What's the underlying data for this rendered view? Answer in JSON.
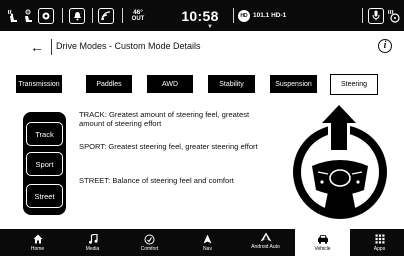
{
  "status_bar": {
    "temperature_value": "46°",
    "temperature_unit": "OUT",
    "time": "10:58",
    "radio_badge": "HD",
    "radio_station": "101.1 HD-1",
    "icons": [
      "seat-heat-icon",
      "seat-cool-icon",
      "camera-icon",
      "bell-icon",
      "wifi-signal-icon",
      "microphone-icon",
      "heated-steering-wheel-icon"
    ]
  },
  "header": {
    "back_glyph": "←",
    "title": "Drive Modes - Custom Mode Details",
    "info_glyph": "i"
  },
  "tabs": [
    {
      "label": "Transmission",
      "active": false
    },
    {
      "label": "Paddles",
      "active": false
    },
    {
      "label": "AWD",
      "active": false
    },
    {
      "label": "Stability",
      "active": false
    },
    {
      "label": "Suspension",
      "active": false
    },
    {
      "label": "Steering",
      "active": true
    }
  ],
  "selector": {
    "options": [
      "Track",
      "Sport",
      "Street"
    ]
  },
  "descriptions": [
    "TRACK: Greatest amount of steering feel, greatest amount of steering effort",
    "SPORT: Greatest steering feel, greater steering effort",
    "STREET: Balance of steering feel and comfort"
  ],
  "illustration": {
    "icon": "steering-wheel-with-up-arrow-icon"
  },
  "bottom_nav": {
    "items": [
      {
        "label": "Home",
        "icon": "home-icon",
        "active": false
      },
      {
        "label": "Media",
        "icon": "music-note-icon",
        "active": false
      },
      {
        "label": "Comfort",
        "icon": "comfort-icon",
        "active": false
      },
      {
        "label": "Nav",
        "icon": "navigation-arrow-icon",
        "active": false
      },
      {
        "label": "Android Auto",
        "icon": "android-auto-icon",
        "active": false
      },
      {
        "label": "Vehicle",
        "icon": "car-icon",
        "active": true
      },
      {
        "label": "Apps",
        "icon": "apps-grid-icon",
        "active": false
      }
    ]
  },
  "colors": {
    "bar_background": "#0a0a0a",
    "foreground": "#ffffff",
    "text": "#111111"
  }
}
